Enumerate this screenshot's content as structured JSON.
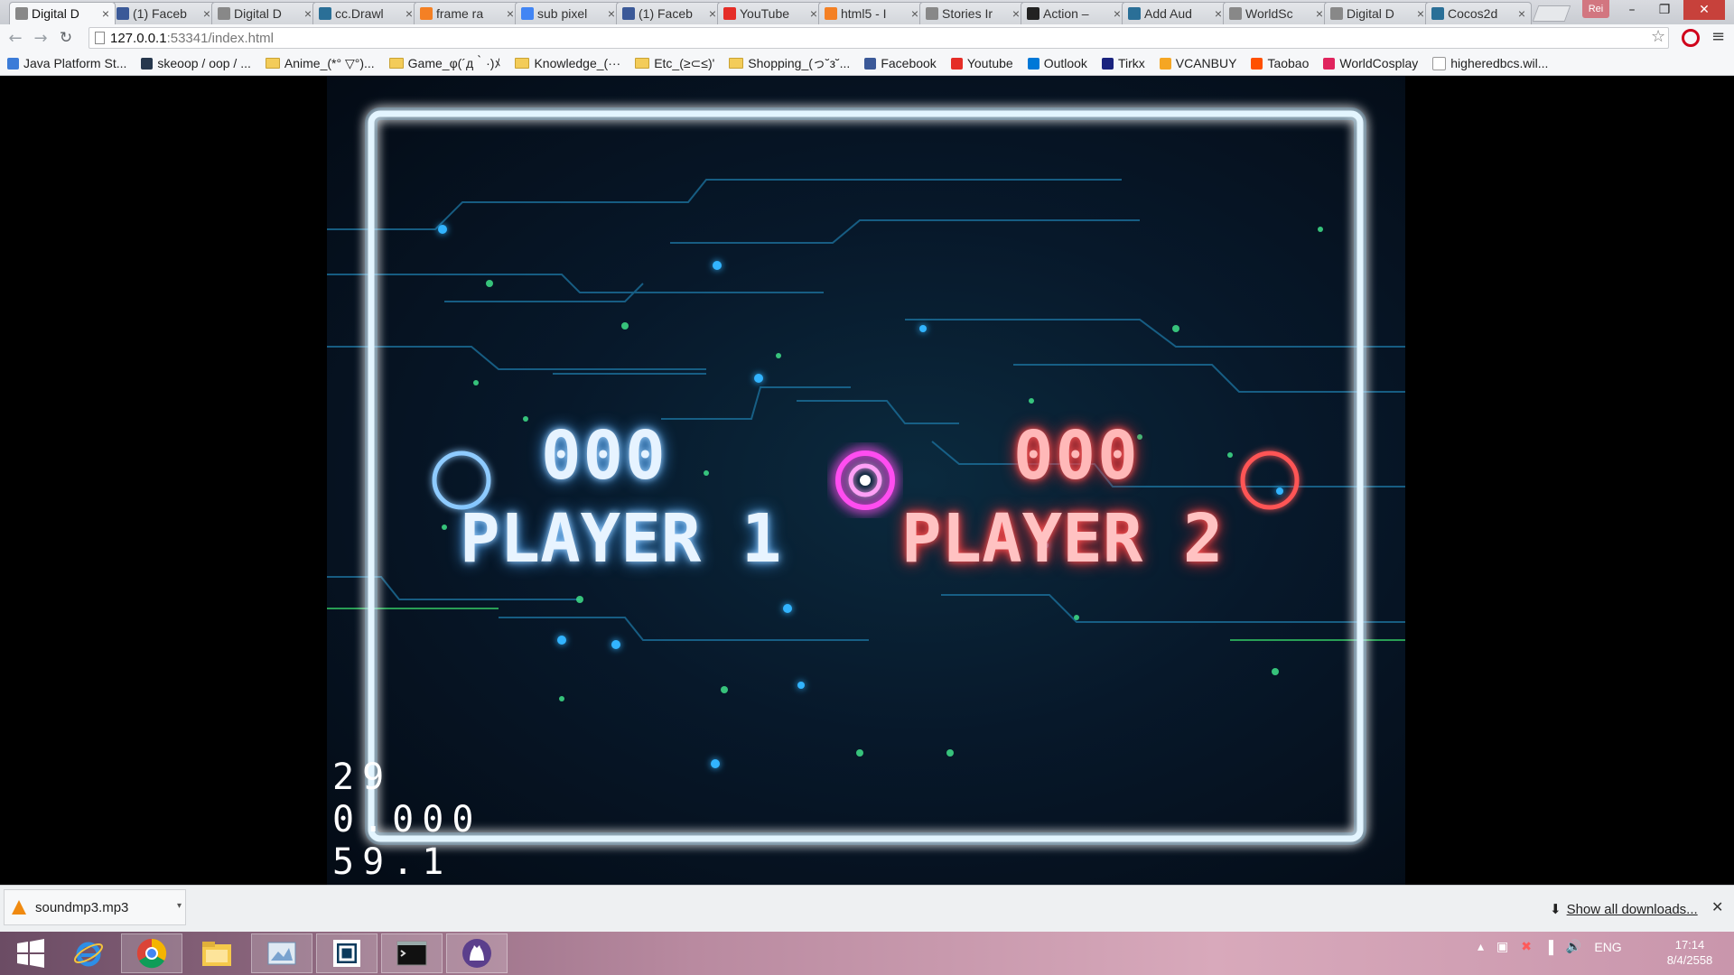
{
  "browser": {
    "tabs": [
      {
        "label": "Digital D",
        "icon": "page-icon",
        "color": "#888888",
        "active": true
      },
      {
        "label": "(1) Faceb",
        "icon": "facebook-icon",
        "color": "#3b5998"
      },
      {
        "label": "Digital D",
        "icon": "page-icon",
        "color": "#888888"
      },
      {
        "label": "cc.Drawl",
        "icon": "cocos-icon",
        "color": "#2a6f97"
      },
      {
        "label": "frame ra",
        "icon": "so-icon",
        "color": "#f48024"
      },
      {
        "label": "sub pixel",
        "icon": "google-icon",
        "color": "#4285f4"
      },
      {
        "label": "(1) Faceb",
        "icon": "facebook-icon",
        "color": "#3b5998"
      },
      {
        "label": "YouTube",
        "icon": "youtube-icon",
        "color": "#e52d27"
      },
      {
        "label": "html5 - I",
        "icon": "so-icon",
        "color": "#f48024"
      },
      {
        "label": "Stories Ir",
        "icon": "page-icon",
        "color": "#888888"
      },
      {
        "label": "Action –",
        "icon": "cocos-icon",
        "color": "#222222"
      },
      {
        "label": "Add Aud",
        "icon": "cocos-icon",
        "color": "#2a6f97"
      },
      {
        "label": "WorldSc",
        "icon": "page-icon",
        "color": "#888888"
      },
      {
        "label": "Digital D",
        "icon": "page-icon",
        "color": "#888888"
      },
      {
        "label": "Cocos2d",
        "icon": "cocos-icon",
        "color": "#2a6f97"
      }
    ],
    "profile_label": "Rei",
    "url_host": "127.0.0.1",
    "url_path": ":53341/index.html",
    "bookmarks": [
      {
        "label": "Java Platform St...",
        "type": "site",
        "color": "#3c7cd8"
      },
      {
        "label": "skeoop / oop / ...",
        "type": "site",
        "color": "#26374d"
      },
      {
        "label": "Anime_(*° ▽°)...",
        "type": "folder"
      },
      {
        "label": "Game_φ(´д｀·)ﾒ",
        "type": "folder"
      },
      {
        "label": "Knowledge_(···",
        "type": "folder"
      },
      {
        "label": "Etc_(≥⊂≤)'",
        "type": "folder"
      },
      {
        "label": "Shopping_(っ˘з˘...",
        "type": "folder"
      },
      {
        "label": "Facebook",
        "type": "site",
        "color": "#3b5998"
      },
      {
        "label": "Youtube",
        "type": "site",
        "color": "#e52d27"
      },
      {
        "label": "Outlook",
        "type": "site",
        "color": "#0078d7"
      },
      {
        "label": "Tirkx",
        "type": "site",
        "color": "#1a237e"
      },
      {
        "label": "VCANBUY",
        "type": "site",
        "color": "#f5a623"
      },
      {
        "label": "Taobao",
        "type": "site",
        "color": "#ff5000"
      },
      {
        "label": "WorldCosplay",
        "type": "site",
        "color": "#e0245e"
      },
      {
        "label": "higheredbcs.wil...",
        "type": "page"
      }
    ]
  },
  "game": {
    "player1": {
      "score": "000",
      "name": "PLAYER 1",
      "color": "#4aa8ff"
    },
    "player2": {
      "score": "000",
      "name": "PLAYER 2",
      "color": "#ff3b3b"
    },
    "center_color": "#ff4df0",
    "debug_stats": [
      "29",
      "0.000",
      "59.1"
    ]
  },
  "downloads": {
    "file_name": "soundmp3.mp3",
    "show_all_label": "Show all downloads..."
  },
  "taskbar": {
    "apps": [
      "windows-start-icon",
      "internet-explorer-icon",
      "chrome-icon",
      "file-explorer-icon",
      "paint-icon",
      "webstorm-icon",
      "cmd-icon",
      "github-icon"
    ],
    "language": "ENG",
    "time": "17:14",
    "date": "8/4/2558"
  }
}
